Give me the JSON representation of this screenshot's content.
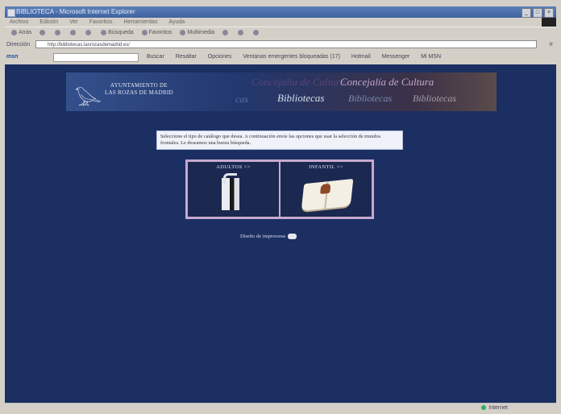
{
  "window": {
    "title": "BIBLIOTECA - Microsoft Internet Explorer",
    "controls": [
      "_",
      "□",
      "×"
    ]
  },
  "menu": [
    "Archivo",
    "Edición",
    "Ver",
    "Favoritos",
    "Herramientas",
    "Ayuda"
  ],
  "toolbar": {
    "back": "Atrás",
    "search": "Búsqueda",
    "favorites": "Favoritos",
    "multimedia": "Multimedia"
  },
  "address": {
    "label": "Dirección",
    "url": "http://bibliotecas.lasrozasdemadrid.es/",
    "go": "Ir"
  },
  "msn": {
    "brand": "msn",
    "links": [
      "Buscar",
      "Resaltar",
      "Opciones",
      "Ventanas emergentes bloqueadas (17)",
      "Hotmail",
      "Messenger",
      "Mi MSN"
    ]
  },
  "banner": {
    "org_line1": "AYUNTAMIENTO DE",
    "org_line2": "LAS ROZAS DE MADRID",
    "phrases": [
      "Concejalía de Cultura",
      "Concejalía de Cultura",
      "cas",
      "Bibliotecas",
      "Bibliotecas",
      "Bibliotecas"
    ]
  },
  "instructions": "Seleccione el tipo de catálogo que desea. A continuación envíe las opciones que usar la selección de mundos frontales. Le deseamos una buena búsqueda.",
  "catalogs": {
    "adult_label": "ADULTOS >>",
    "child_label": "INFANTIL >>"
  },
  "helper": {
    "text": "Diseño de impresoras"
  },
  "status": {
    "left": "",
    "zone": "Internet"
  }
}
